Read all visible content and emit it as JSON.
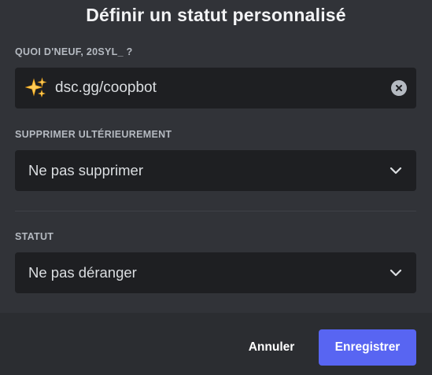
{
  "modal": {
    "title": "Définir un statut personnalisé"
  },
  "custom_status": {
    "label": "QUOI D'NEUF, 20SYL_ ?",
    "emoji": "sparkles-icon",
    "value": "dsc.gg/coopbot"
  },
  "clear_after": {
    "label": "SUPPRIMER ULTÉRIEUREMENT",
    "selected": "Ne pas supprimer"
  },
  "status": {
    "label": "STATUT",
    "selected": "Ne pas déranger"
  },
  "footer": {
    "cancel_label": "Annuler",
    "save_label": "Enregistrer"
  },
  "colors": {
    "accent": "#5865f2",
    "background": "#313338",
    "field": "#1e1f22",
    "footer": "#2b2d31"
  }
}
